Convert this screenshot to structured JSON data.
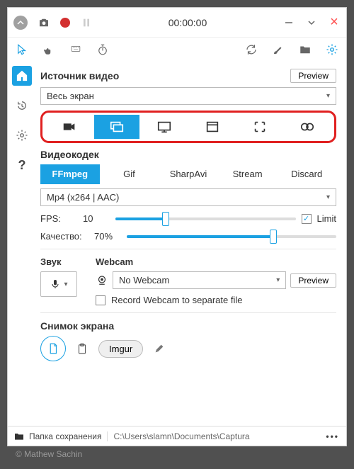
{
  "titlebar": {
    "timer": "00:00:00"
  },
  "main": {
    "video_source": {
      "title": "Источник видео",
      "preview_btn": "Preview",
      "selected": "Весь экран"
    },
    "codec": {
      "title": "Видеокодек",
      "tabs": {
        "ffmpeg": "FFmpeg",
        "gif": "Gif",
        "sharpavi": "SharpAvi",
        "stream": "Stream",
        "discard": "Discard"
      },
      "format": "Mp4 (x264 | AAC)"
    },
    "fps": {
      "label": "FPS:",
      "value": "10",
      "limit_label": "Limit"
    },
    "quality": {
      "label": "Качество:",
      "value": "70%"
    },
    "sound": {
      "title": "Звук"
    },
    "webcam": {
      "title": "Webcam",
      "selected": "No Webcam",
      "preview_btn": "Preview",
      "separate_label": "Record Webcam to separate file"
    },
    "screenshot": {
      "title": "Снимок экрана",
      "imgur_btn": "Imgur"
    }
  },
  "statusbar": {
    "folder_label": "Папка сохранения",
    "path": "C:\\Users\\slamn\\Documents\\Captura",
    "more": "•••"
  },
  "credit": "© Mathew Sachin"
}
